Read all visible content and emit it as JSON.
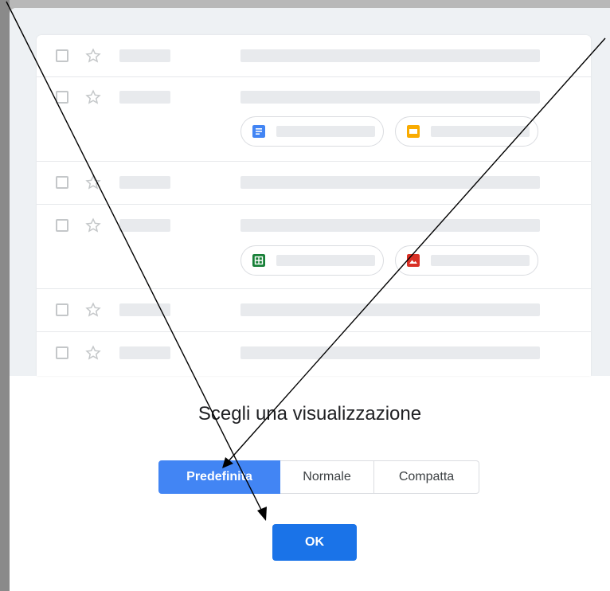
{
  "dialog": {
    "title": "Scegli una visualizzazione",
    "view_options": [
      {
        "label": "Predefinita",
        "selected": true
      },
      {
        "label": "Normale",
        "selected": false
      },
      {
        "label": "Compatta",
        "selected": false
      }
    ],
    "ok_label": "OK"
  },
  "preview": {
    "attachment_icons": [
      "docs-icon",
      "slides-icon",
      "sheets-icon",
      "image-icon"
    ]
  },
  "colors": {
    "accent": "#1a73e8",
    "selected_option": "#4285f4",
    "docs": "#4285f4",
    "slides": "#f9ab00",
    "sheets": "#188038",
    "image": "#d93025",
    "annotation_arrow": "#000000"
  }
}
